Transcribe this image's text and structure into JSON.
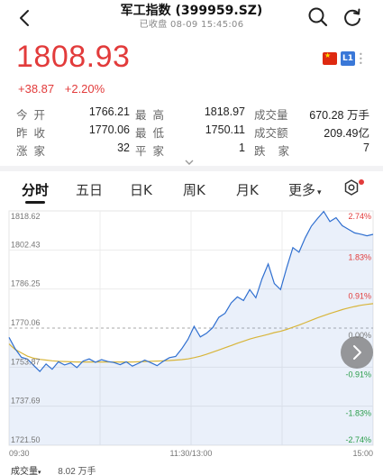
{
  "header": {
    "title": "军工指数 (399959.SZ)",
    "status": "已收盘",
    "datetime": "08-09 15:45:06"
  },
  "quote": {
    "price": "1808.93",
    "change": "+38.87",
    "change_pct": "+2.20%",
    "level_badge": "L1",
    "price_color": "#e23b3b"
  },
  "stats": {
    "rows": [
      [
        {
          "label": "今开",
          "value": "1766.21"
        },
        {
          "label": "最高",
          "value": "1818.97"
        },
        {
          "label": "成交量",
          "value": "670.28 万手"
        }
      ],
      [
        {
          "label": "昨收",
          "value": "1770.06"
        },
        {
          "label": "最低",
          "value": "1750.11"
        },
        {
          "label": "成交额",
          "value": "209.49亿"
        }
      ],
      [
        {
          "label": "涨家",
          "value": "32"
        },
        {
          "label": "平家",
          "value": "1"
        },
        {
          "label": "跌家",
          "value": "7"
        }
      ]
    ]
  },
  "tabs": {
    "items": [
      "分时",
      "五日",
      "日K",
      "周K",
      "月K",
      "更多"
    ],
    "active": "分时",
    "more_caret": "▾"
  },
  "icons": {
    "back": "chevron-left-icon",
    "search": "search-icon",
    "refresh": "refresh-icon",
    "flag": "china-flag-icon",
    "settings": "settings-icon",
    "expand": "chevron-down-icon",
    "next": "chevron-right-icon"
  },
  "volume": {
    "label": "成交量",
    "caret": "▾",
    "value": "8.02 万手"
  },
  "chart_data": {
    "type": "line",
    "x_ticks": [
      "09:30",
      "11:30/13:00",
      "15:00"
    ],
    "y_left_ticks": [
      "1818.62",
      "1802.43",
      "1786.25",
      "1770.06",
      "1753.87",
      "1737.69",
      "1721.50"
    ],
    "y_right_ticks": [
      "2.74%",
      "1.83%",
      "0.91%",
      "0.00%",
      "-0.91%",
      "-1.83%",
      "-2.74%"
    ],
    "ylim": [
      1721.5,
      1818.62
    ],
    "prev_close": 1770.06,
    "series": [
      {
        "color": "#2f6fd0",
        "values": [
          1766.2,
          1761.5,
          1758.0,
          1757.2,
          1754.6,
          1752.1,
          1755.2,
          1753.0,
          1756.1,
          1754.8,
          1755.6,
          1753.7,
          1756.4,
          1757.3,
          1755.9,
          1757.0,
          1756.2,
          1755.8,
          1754.9,
          1756.1,
          1754.3,
          1755.5,
          1756.8,
          1755.7,
          1754.5,
          1756.3,
          1757.8,
          1758.3,
          1761.5,
          1765.4,
          1770.8,
          1766.4,
          1767.9,
          1770.2,
          1774.5,
          1776.2,
          1780.5,
          1783.0,
          1781.5,
          1786.0,
          1782.6,
          1790.4,
          1796.6,
          1788.5,
          1786.0,
          1795.0,
          1803.4,
          1801.5,
          1807.5,
          1812.3,
          1815.5,
          1818.4,
          1814.2,
          1815.8,
          1812.5,
          1811.0,
          1809.5,
          1809.0,
          1808.3,
          1808.9
        ]
      },
      {
        "color": "#d8b53a",
        "values": [
          1763.5,
          1761.2,
          1759.8,
          1758.4,
          1757.6,
          1757.1,
          1756.8,
          1756.5,
          1756.3,
          1756.2,
          1756.1,
          1756.0,
          1756.0,
          1756.0,
          1756.0,
          1756.0,
          1756.0,
          1756.0,
          1756.0,
          1756.0,
          1756.0,
          1756.1,
          1756.2,
          1756.3,
          1756.4,
          1756.5,
          1756.6,
          1756.8,
          1757.0,
          1757.3,
          1757.8,
          1758.4,
          1759.2,
          1760.1,
          1761.0,
          1761.9,
          1762.8,
          1763.8,
          1764.6,
          1765.5,
          1766.2,
          1766.8,
          1767.5,
          1768.2,
          1768.7,
          1769.5,
          1770.4,
          1771.3,
          1772.3,
          1773.3,
          1774.3,
          1775.2,
          1776.1,
          1776.9,
          1777.7,
          1778.4,
          1779.0,
          1779.5,
          1779.9,
          1780.2
        ]
      }
    ]
  }
}
